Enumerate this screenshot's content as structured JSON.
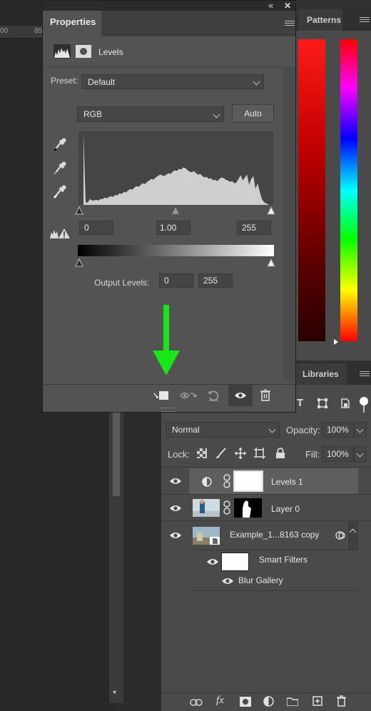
{
  "ruler": {
    "text": "00",
    "text2": "85"
  },
  "patterns_panel": {
    "tab": "Patterns"
  },
  "libraries_panel": {
    "tab": "Libraries"
  },
  "properties": {
    "tab": "Properties",
    "collapse_glyph": "«",
    "close_glyph": "✕",
    "type_label": "Levels",
    "preset_label": "Preset:",
    "preset_value": "Default",
    "channel_value": "RGB",
    "auto_label": "Auto",
    "input_black": "0",
    "input_gamma": "1.00",
    "input_white": "255",
    "output_label": "Output Levels:",
    "output_black": "0",
    "output_white": "255",
    "histogram_values": [
      100,
      4,
      3,
      8,
      6,
      6,
      7,
      6,
      8,
      8,
      10,
      9,
      11,
      12,
      11,
      14,
      13,
      16,
      15,
      18,
      17,
      20,
      22,
      21,
      24,
      26,
      25,
      28,
      30,
      29,
      32,
      34,
      36,
      35,
      38,
      40,
      42,
      41,
      40,
      42,
      44,
      43,
      46,
      48,
      47,
      50,
      49,
      52,
      51,
      48,
      46,
      45,
      47,
      44,
      42,
      43,
      40,
      38,
      39,
      36,
      37,
      34,
      35,
      33,
      36,
      38,
      37,
      35,
      34,
      32,
      33,
      30,
      31,
      36,
      41,
      34,
      38,
      42,
      28,
      36,
      40,
      22,
      30,
      18,
      8,
      4,
      2,
      1
    ]
  },
  "arrow_annotation": {
    "color": "#19e619"
  },
  "layers": {
    "blend_mode": "Normal",
    "opacity_label": "Opacity:",
    "opacity_value": "100%",
    "lock_label": "Lock:",
    "fill_label": "Fill:",
    "fill_value": "100%",
    "items": [
      {
        "name": "Levels 1"
      },
      {
        "name": "Layer 0"
      },
      {
        "name": "Example_1...8163 copy"
      },
      {
        "name": "Smart Filters"
      },
      {
        "name": "Blur Gallery"
      }
    ]
  }
}
